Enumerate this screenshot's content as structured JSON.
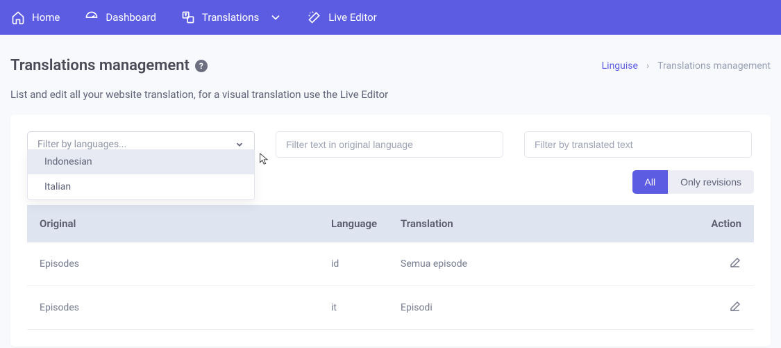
{
  "nav": {
    "home": "Home",
    "dashboard": "Dashboard",
    "translations": "Translations",
    "live_editor": "Live Editor"
  },
  "header": {
    "title": "Translations management",
    "breadcrumb_root": "Linguise",
    "breadcrumb_sep": "›",
    "breadcrumb_current": "Translations management"
  },
  "description": "List and edit all your website translation, for a visual translation use the Live Editor",
  "filters": {
    "language_placeholder": "Filter by languages...",
    "original_placeholder": "Filter text in original language",
    "translated_placeholder": "Filter by translated text",
    "dropdown": {
      "options": [
        "Indonesian",
        "Italian"
      ],
      "highlighted": 0
    }
  },
  "toggle": {
    "all": "All",
    "only_revisions": "Only revisions"
  },
  "table": {
    "columns": {
      "original": "Original",
      "language": "Language",
      "translation": "Translation",
      "action": "Action"
    },
    "rows": [
      {
        "original": "Episodes",
        "language": "id",
        "translation": "Semua episode"
      },
      {
        "original": "Episodes",
        "language": "it",
        "translation": "Episodi"
      }
    ]
  }
}
